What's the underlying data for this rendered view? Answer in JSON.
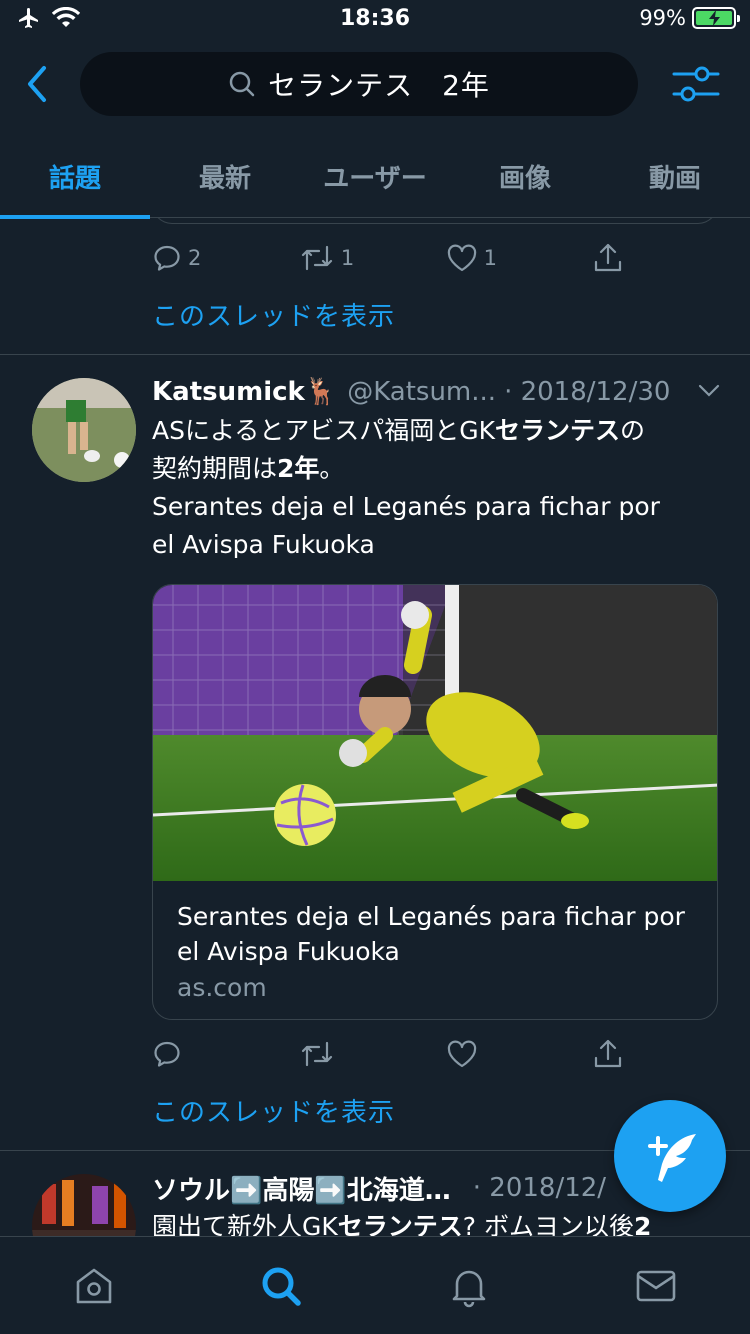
{
  "status_bar": {
    "time": "18:36",
    "battery": "99%"
  },
  "search": {
    "query": "セランテス　2年"
  },
  "tabs": [
    {
      "label": "話題",
      "active": true
    },
    {
      "label": "最新",
      "active": false
    },
    {
      "label": "ユーザー",
      "active": false
    },
    {
      "label": "画像",
      "active": false
    },
    {
      "label": "動画",
      "active": false
    }
  ],
  "prev_tweet": {
    "reply_count": "2",
    "retweet_count": "1",
    "like_count": "1",
    "thread_link": "このスレッドを表示"
  },
  "tweet": {
    "name": "Katsumick🦌",
    "handle": "@Katsum...",
    "date": "· 2018/12/30",
    "text_line1_a": "ASによるとアビスパ福岡とGK",
    "text_line1_b": "セランテス",
    "text_line1_c": "の",
    "text_line2_a": "契約期間は",
    "text_line2_b": "2年",
    "text_line2_c": "。",
    "text_line3": "Serantes deja el Leganés para fichar por",
    "text_line4": "el Avispa Fukuoka",
    "card_title": "Serantes deja el Leganés para fichar por el Avispa Fukuoka",
    "card_domain": "as.com",
    "thread_link": "このスレッドを表示"
  },
  "next_tweet": {
    "name": "ソウル➡️高陽➡️北海道…",
    "date": "· 2018/12/",
    "text_a": "園出て新外人GK",
    "text_b": "セランテス",
    "text_c": "? ボムヨン以後",
    "text_d": "2"
  },
  "colors": {
    "accent": "#1da1f2",
    "background": "#15202b",
    "muted": "#8899a6",
    "border": "#38444d"
  }
}
